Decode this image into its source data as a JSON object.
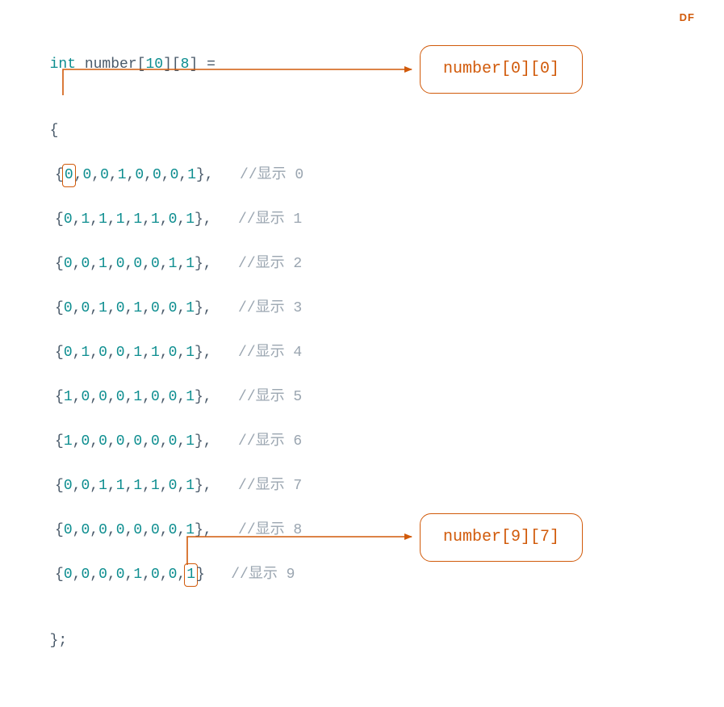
{
  "watermark": "DF",
  "declaration": {
    "keyword": "int",
    "name": "number",
    "dim1": "10",
    "dim2": "8",
    "assign": "="
  },
  "brace_open": "{",
  "brace_close": "};",
  "rows": [
    {
      "values": [
        "0",
        "0",
        "0",
        "1",
        "0",
        "0",
        "0",
        "1"
      ],
      "trail": ",",
      "comment": "//显示 0",
      "highlight_index": 0
    },
    {
      "values": [
        "0",
        "1",
        "1",
        "1",
        "1",
        "1",
        "0",
        "1"
      ],
      "trail": ",",
      "comment": "//显示 1",
      "highlight_index": -1
    },
    {
      "values": [
        "0",
        "0",
        "1",
        "0",
        "0",
        "0",
        "1",
        "1"
      ],
      "trail": ",",
      "comment": "//显示 2",
      "highlight_index": -1
    },
    {
      "values": [
        "0",
        "0",
        "1",
        "0",
        "1",
        "0",
        "0",
        "1"
      ],
      "trail": ",",
      "comment": "//显示 3",
      "highlight_index": -1
    },
    {
      "values": [
        "0",
        "1",
        "0",
        "0",
        "1",
        "1",
        "0",
        "1"
      ],
      "trail": ",",
      "comment": "//显示 4",
      "highlight_index": -1
    },
    {
      "values": [
        "1",
        "0",
        "0",
        "0",
        "1",
        "0",
        "0",
        "1"
      ],
      "trail": ",",
      "comment": "//显示 5",
      "highlight_index": -1
    },
    {
      "values": [
        "1",
        "0",
        "0",
        "0",
        "0",
        "0",
        "0",
        "1"
      ],
      "trail": ",",
      "comment": "//显示 6",
      "highlight_index": -1
    },
    {
      "values": [
        "0",
        "0",
        "1",
        "1",
        "1",
        "1",
        "0",
        "1"
      ],
      "trail": ",",
      "comment": "//显示 7",
      "highlight_index": -1
    },
    {
      "values": [
        "0",
        "0",
        "0",
        "0",
        "0",
        "0",
        "0",
        "1"
      ],
      "trail": ",",
      "comment": "//显示 8",
      "highlight_index": -1
    },
    {
      "values": [
        "0",
        "0",
        "0",
        "0",
        "1",
        "0",
        "0",
        "1"
      ],
      "trail": "",
      "comment": "//显示 9",
      "highlight_index": 7
    }
  ],
  "callouts": {
    "top": "number[0][0]",
    "bottom": "number[9][7]"
  }
}
